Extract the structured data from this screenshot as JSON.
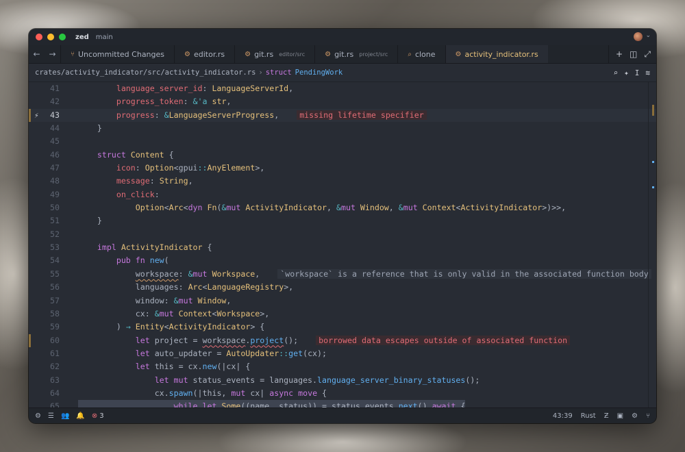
{
  "titlebar": {
    "app": "zed",
    "branch": "main"
  },
  "tabs": [
    {
      "label": "Uncommitted Changes",
      "sub": "",
      "icon": "git-branch-icon"
    },
    {
      "label": "editor.rs",
      "sub": "",
      "icon": "rust-icon"
    },
    {
      "label": "git.rs",
      "sub": "editor/src",
      "icon": "rust-icon"
    },
    {
      "label": "git.rs",
      "sub": "project/src",
      "icon": "rust-icon"
    },
    {
      "label": "clone",
      "sub": "",
      "icon": "search-icon"
    },
    {
      "label": "activity_indicator.rs",
      "sub": "",
      "icon": "rust-icon",
      "active": true
    }
  ],
  "breadcrumbs": {
    "path": "crates/activity_indicator/src/activity_indicator.rs",
    "sep": "›",
    "kind": "struct",
    "symbol": "PendingWork"
  },
  "lines": [
    {
      "n": "41",
      "t": [
        [
          "        ",
          "pl"
        ],
        [
          "language_server_id",
          "pr"
        ],
        [
          ": ",
          "pl"
        ],
        [
          "LanguageServerId",
          "ty"
        ],
        [
          ",",
          "pl"
        ]
      ]
    },
    {
      "n": "42",
      "t": [
        [
          "        ",
          "pl"
        ],
        [
          "progress_token",
          "pr"
        ],
        [
          ": ",
          "pl"
        ],
        [
          "&",
          "op"
        ],
        [
          "'a ",
          "tl"
        ],
        [
          "str",
          "ty"
        ],
        [
          ",",
          "pl"
        ]
      ]
    },
    {
      "n": "43",
      "current": true,
      "icon": "⚡",
      "t": [
        [
          "        ",
          "pl"
        ],
        [
          "progress",
          "pr"
        ],
        [
          ": ",
          "pl"
        ],
        [
          "&",
          "op"
        ],
        [
          "LanguageServerProgress",
          "ty"
        ],
        [
          ",",
          "pl"
        ]
      ],
      "diag": "missing lifetime specifier"
    },
    {
      "n": "44",
      "t": [
        [
          "    }",
          "pl"
        ]
      ]
    },
    {
      "n": "45",
      "t": []
    },
    {
      "n": "46",
      "t": [
        [
          "    ",
          "pl"
        ],
        [
          "struct ",
          "k"
        ],
        [
          "Content ",
          "ty"
        ],
        [
          "{",
          "pl"
        ]
      ]
    },
    {
      "n": "47",
      "t": [
        [
          "        ",
          "pl"
        ],
        [
          "icon",
          "pr"
        ],
        [
          ": ",
          "pl"
        ],
        [
          "Option",
          "ty"
        ],
        [
          "<",
          "pl"
        ],
        [
          "gpui",
          "pl"
        ],
        [
          "::",
          "op"
        ],
        [
          "AnyElement",
          "ty"
        ],
        [
          ">,",
          "pl"
        ]
      ]
    },
    {
      "n": "48",
      "t": [
        [
          "        ",
          "pl"
        ],
        [
          "message",
          "pr"
        ],
        [
          ": ",
          "pl"
        ],
        [
          "String",
          "ty"
        ],
        [
          ",",
          "pl"
        ]
      ]
    },
    {
      "n": "49",
      "t": [
        [
          "        ",
          "pl"
        ],
        [
          "on_click",
          "pr"
        ],
        [
          ":",
          "pl"
        ]
      ]
    },
    {
      "n": "50",
      "t": [
        [
          "            ",
          "pl"
        ],
        [
          "Option",
          "ty"
        ],
        [
          "<",
          "pl"
        ],
        [
          "Arc",
          "ty"
        ],
        [
          "<",
          "pl"
        ],
        [
          "dyn ",
          "k"
        ],
        [
          "Fn",
          "ty"
        ],
        [
          "(",
          "pl"
        ],
        [
          "&",
          "op"
        ],
        [
          "mut ",
          "k"
        ],
        [
          "ActivityIndicator",
          "ty"
        ],
        [
          ", ",
          "pl"
        ],
        [
          "&",
          "op"
        ],
        [
          "mut ",
          "k"
        ],
        [
          "Window",
          "ty"
        ],
        [
          ", ",
          "pl"
        ],
        [
          "&",
          "op"
        ],
        [
          "mut ",
          "k"
        ],
        [
          "Context",
          "ty"
        ],
        [
          "<",
          "pl"
        ],
        [
          "ActivityIndicator",
          "ty"
        ],
        [
          ">)>>,",
          "pl"
        ]
      ]
    },
    {
      "n": "51",
      "t": [
        [
          "    }",
          "pl"
        ]
      ]
    },
    {
      "n": "52",
      "t": []
    },
    {
      "n": "53",
      "t": [
        [
          "    ",
          "pl"
        ],
        [
          "impl ",
          "k"
        ],
        [
          "ActivityIndicator ",
          "ty"
        ],
        [
          "{",
          "pl"
        ]
      ]
    },
    {
      "n": "54",
      "t": [
        [
          "        ",
          "pl"
        ],
        [
          "pub ",
          "k"
        ],
        [
          "fn ",
          "k"
        ],
        [
          "new",
          "fn"
        ],
        [
          "(",
          "pl"
        ]
      ]
    },
    {
      "n": "55",
      "t": [
        [
          "            ",
          "pl"
        ],
        [
          "workspace",
          "pl",
          "sqy"
        ],
        [
          ": ",
          "pl"
        ],
        [
          "&",
          "op"
        ],
        [
          "mut ",
          "k"
        ],
        [
          "Workspace",
          "ty"
        ],
        [
          ",",
          "pl"
        ]
      ],
      "hint": "`workspace` is a reference that is only valid in the associated function body"
    },
    {
      "n": "56",
      "t": [
        [
          "            ",
          "pl"
        ],
        [
          "languages",
          "pl"
        ],
        [
          ": ",
          "pl"
        ],
        [
          "Arc",
          "ty"
        ],
        [
          "<",
          "pl"
        ],
        [
          "LanguageRegistry",
          "ty"
        ],
        [
          ">,",
          "pl"
        ]
      ]
    },
    {
      "n": "57",
      "t": [
        [
          "            ",
          "pl"
        ],
        [
          "window",
          "pl"
        ],
        [
          ": ",
          "pl"
        ],
        [
          "&",
          "op"
        ],
        [
          "mut ",
          "k"
        ],
        [
          "Window",
          "ty"
        ],
        [
          ",",
          "pl"
        ]
      ]
    },
    {
      "n": "58",
      "t": [
        [
          "            ",
          "pl"
        ],
        [
          "cx",
          "pl"
        ],
        [
          ": ",
          "pl"
        ],
        [
          "&",
          "op"
        ],
        [
          "mut ",
          "k"
        ],
        [
          "Context",
          "ty"
        ],
        [
          "<",
          "pl"
        ],
        [
          "Workspace",
          "ty"
        ],
        [
          ">,",
          "pl"
        ]
      ]
    },
    {
      "n": "59",
      "t": [
        [
          "        ) ",
          "pl"
        ],
        [
          "→ ",
          "op"
        ],
        [
          "Entity",
          "ty"
        ],
        [
          "<",
          "pl"
        ],
        [
          "ActivityIndicator",
          "ty"
        ],
        [
          "> {",
          "pl"
        ]
      ]
    },
    {
      "n": "60",
      "mod": true,
      "t": [
        [
          "            ",
          "pl"
        ],
        [
          "let ",
          "k"
        ],
        [
          "project = ",
          "pl"
        ],
        [
          "workspace",
          "pl",
          "sq"
        ],
        [
          ".",
          "pl"
        ],
        [
          "project",
          "fn",
          "sq"
        ],
        [
          "();",
          "pl"
        ]
      ],
      "diag": "borrowed data escapes outside of associated function"
    },
    {
      "n": "61",
      "t": [
        [
          "            ",
          "pl"
        ],
        [
          "let ",
          "k"
        ],
        [
          "auto_updater = ",
          "pl"
        ],
        [
          "AutoUpdater",
          "ty"
        ],
        [
          "::",
          "op"
        ],
        [
          "get",
          "fn"
        ],
        [
          "(cx);",
          "pl"
        ]
      ]
    },
    {
      "n": "62",
      "t": [
        [
          "            ",
          "pl"
        ],
        [
          "let ",
          "k"
        ],
        [
          "this = cx.",
          "pl"
        ],
        [
          "new",
          "fn"
        ],
        [
          "(|cx| {",
          "pl"
        ]
      ]
    },
    {
      "n": "63",
      "t": [
        [
          "                ",
          "pl"
        ],
        [
          "let ",
          "k"
        ],
        [
          "mut ",
          "k"
        ],
        [
          "status_events = languages.",
          "pl"
        ],
        [
          "language_server_binary_statuses",
          "fn"
        ],
        [
          "();",
          "pl"
        ]
      ]
    },
    {
      "n": "64",
      "t": [
        [
          "                ",
          "pl"
        ],
        [
          "cx.",
          "pl"
        ],
        [
          "spawn",
          "fn"
        ],
        [
          "(|this, ",
          "pl"
        ],
        [
          "mut ",
          "k"
        ],
        [
          "cx| ",
          "pl"
        ],
        [
          "async ",
          "k"
        ],
        [
          "move ",
          "k"
        ],
        [
          "{",
          "pl"
        ]
      ]
    },
    {
      "n": "65",
      "selected": true,
      "t": [
        [
          "                    ",
          "pl"
        ],
        [
          "while ",
          "k"
        ],
        [
          "let ",
          "k"
        ],
        [
          "Some",
          "ty"
        ],
        [
          "((name, status)) = status_events.",
          "pl"
        ],
        [
          "next",
          "fn"
        ],
        [
          "().",
          "pl"
        ],
        [
          "await ",
          "k"
        ],
        [
          "{",
          "pl"
        ]
      ]
    }
  ],
  "statusbar": {
    "errors": "3",
    "position": "43:39",
    "language": "Rust"
  },
  "colors": {
    "background": "#282c34",
    "accent": "#e5c07b",
    "error": "#e06c75"
  }
}
